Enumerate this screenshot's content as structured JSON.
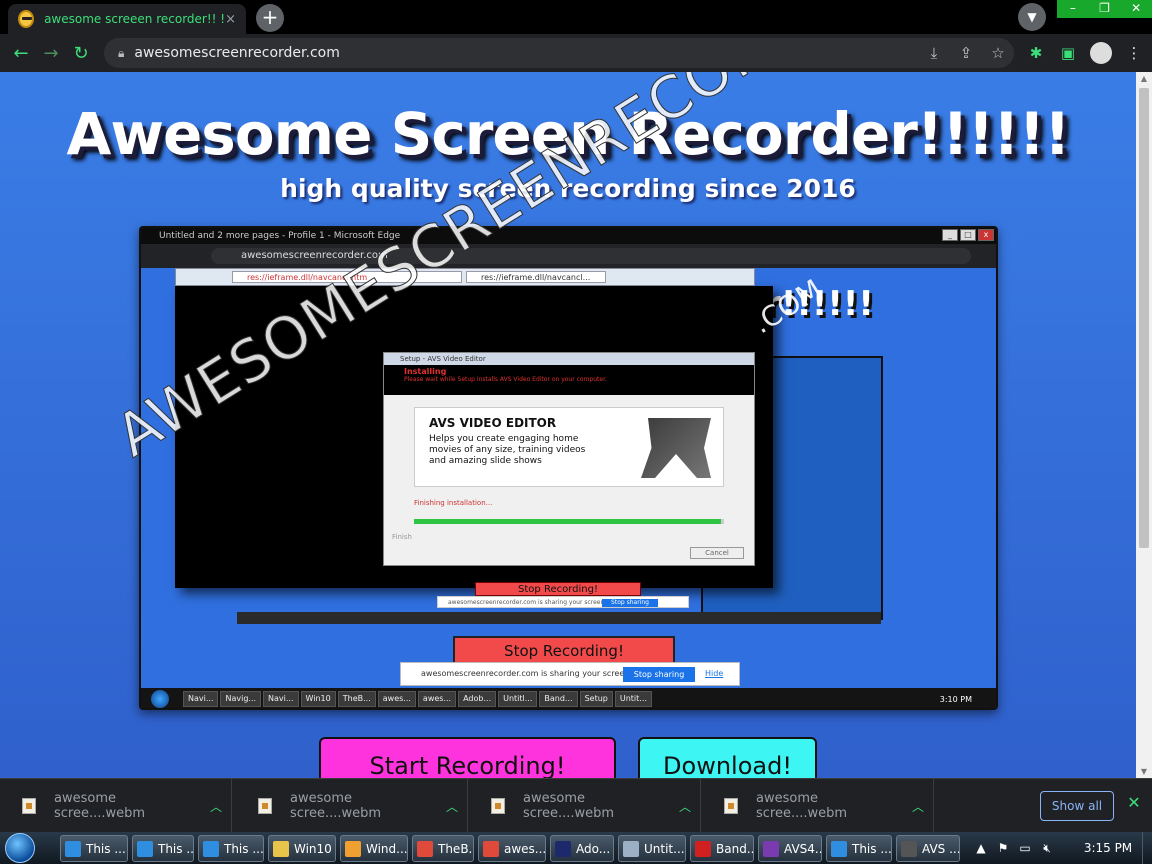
{
  "browser": {
    "tab_title": "awesome screeen recorder!! !",
    "tab_close": "×",
    "newtab": "+",
    "url": "awesomescreenrecorder.com",
    "window_controls": [
      "–",
      "❐",
      "✕"
    ],
    "accent_color": "#3cde7a"
  },
  "page": {
    "title": "Awesome Screen Recorder!!!!!!",
    "subtitle": "high quality screen recording since 2016",
    "start_button": "Start Recording!",
    "download_button": "Download!",
    "preview": {
      "window_title": "Untitled and 2 more pages - Profile 1 - Microsoft Edge",
      "url": "awesomescreenrecorder.com",
      "ie_address": "res://ieframe.dll/navcancl.htm",
      "ie_tab": "res://ieframe.dll/navcancl...",
      "inner_title": "er!!!!!!",
      "dialog_title": "Setup - AVS Video Editor",
      "dialog_status": "Installing",
      "dialog_message": "Please wait while Setup installs AVS Video Editor on your computer.",
      "product_name": "AVS VIDEO EDITOR",
      "product_desc": "Helps you create engaging home movies of any size, training videos and amazing slide shows",
      "finishing_text": "Finishing installation...",
      "progress": 0.99,
      "cancel_label": "Cancel",
      "finish_label": "Finish",
      "stop_recording": "Stop Recording!",
      "share_text": "awesomescreenrecorder.com is sharing your screen.",
      "stop_sharing": "Stop sharing",
      "hide": "Hide",
      "taskbar_items": [
        "Navi...",
        "Navig...",
        "Navi...",
        "Win10",
        "TheB...",
        "awes...",
        "awes...",
        "Adob...",
        "Untitl...",
        "Band...",
        "Setup",
        "Untit..."
      ],
      "clock": "3:10 PM"
    },
    "watermark": "AWESOMESCREENRECORDER.COM",
    "watermark_small": ".COM"
  },
  "downloads": {
    "items": [
      "awesome scree....webm",
      "awesome scree....webm",
      "awesome scree....webm",
      "awesome scree....webm"
    ],
    "show_all": "Show all",
    "close": "✕"
  },
  "taskbar": {
    "items": [
      {
        "label": "This ...",
        "icon_color": "#2f8ee0"
      },
      {
        "label": "This ...",
        "icon_color": "#2f8ee0"
      },
      {
        "label": "This ...",
        "icon_color": "#2f8ee0"
      },
      {
        "label": "Win10",
        "icon_color": "#e8c44a"
      },
      {
        "label": "Wind...",
        "icon_color": "#f0a030"
      },
      {
        "label": "TheB...",
        "icon_color": "#e04a3a"
      },
      {
        "label": "awes...",
        "icon_color": "#e04a3a"
      },
      {
        "label": "Ado...",
        "icon_color": "#1c2a6b"
      },
      {
        "label": "Untit...",
        "icon_color": "#9bb0c4"
      },
      {
        "label": "Band...",
        "icon_color": "#d02020"
      },
      {
        "label": "AVS4...",
        "icon_color": "#7a3ab0"
      },
      {
        "label": "This ...",
        "icon_color": "#2f8ee0"
      },
      {
        "label": "AVS ...",
        "icon_color": "#555"
      }
    ],
    "clock": "3:15 PM"
  }
}
